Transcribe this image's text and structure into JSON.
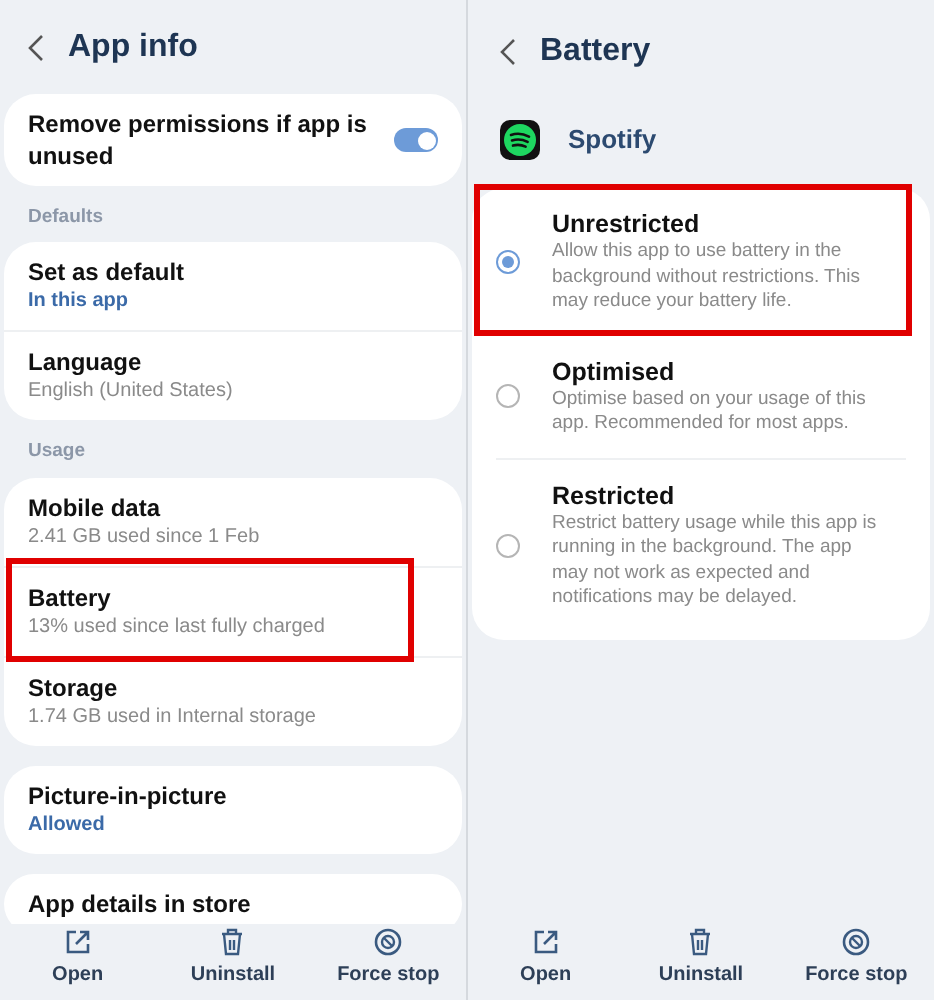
{
  "left": {
    "title": "App info",
    "groups": [
      {
        "items": [
          {
            "kind": "toggle",
            "title": "Remove permissions if app is unused",
            "on": true,
            "highlighted": false
          }
        ]
      },
      {
        "header": "Defaults",
        "items": [
          {
            "kind": "link",
            "title": "Set as default",
            "subtitle": "In this app",
            "accent": true,
            "highlighted": false
          },
          {
            "kind": "link",
            "title": "Language",
            "subtitle": "English (United States)",
            "accent": false,
            "highlighted": false
          }
        ]
      },
      {
        "header": "Usage",
        "items": [
          {
            "kind": "link",
            "title": "Mobile data",
            "subtitle": "2.41 GB used since 1 Feb",
            "accent": false,
            "highlighted": false
          },
          {
            "kind": "link",
            "title": "Battery",
            "subtitle": "13% used since last fully charged",
            "accent": false,
            "highlighted": true
          },
          {
            "kind": "link",
            "title": "Storage",
            "subtitle": "1.74 GB used in Internal storage",
            "accent": false,
            "highlighted": false
          }
        ]
      },
      {
        "items": [
          {
            "kind": "link",
            "title": "Picture-in-picture",
            "subtitle": "Allowed",
            "accent": true,
            "highlighted": false
          }
        ]
      },
      {
        "items": [
          {
            "kind": "link",
            "title": "App details in store",
            "highlighted": false
          }
        ]
      }
    ],
    "actions": [
      "Open",
      "Uninstall",
      "Force stop"
    ]
  },
  "right": {
    "title": "Battery",
    "app": {
      "name": "Spotify"
    },
    "options": [
      {
        "title": "Unrestricted",
        "description": "Allow this app to use battery in the background without restrictions. This may reduce your battery life.",
        "selected": true,
        "highlighted": true
      },
      {
        "title": "Optimised",
        "description": "Optimise based on your usage of this app. Recommended for most apps.",
        "selected": false,
        "highlighted": false
      },
      {
        "title": "Restricted",
        "description": "Restrict battery usage while this app is running in the background. The app may not work as expected and notifications may be delayed.",
        "selected": false,
        "highlighted": false
      }
    ],
    "actions": [
      "Open",
      "Uninstall",
      "Force stop"
    ]
  }
}
